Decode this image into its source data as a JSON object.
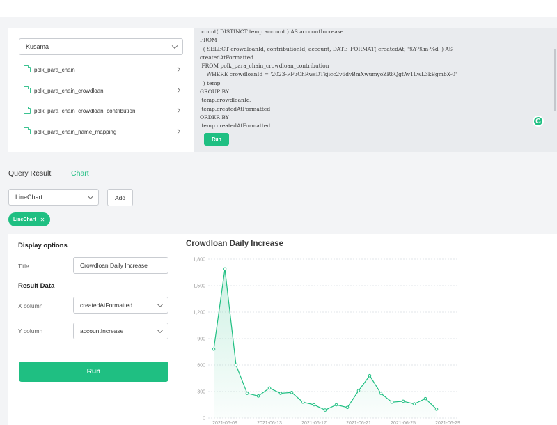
{
  "database_select": {
    "value": "Kusama"
  },
  "tables": [
    {
      "name": "polk_para_chain"
    },
    {
      "name": "polk_para_chain_crowdloan"
    },
    {
      "name": "polk_para_chain_crowdloan_contribution"
    },
    {
      "name": "polk_para_chain_name_mapping"
    }
  ],
  "editor": {
    "code_lines": [
      " count( DISTINCT temp.account ) AS accountIncrease",
      "FROM",
      "  ( SELECT crowdloanId, contributionId, account, DATE_FORMAT( createdAt, '%Y-%m-%d' ) AS",
      "createdAtFormatted",
      " FROM polk_para_chain_crowdloan_contribution",
      "    WHERE crowdloanId = '2023-FFuChRwsDTkjicc2v6dvBmXwumyoZR6QgfAv1LwL3kBgmbX-0'",
      "  ) temp",
      "GROUP BY",
      " temp.crowdloanId,",
      " temp.createdAtFormatted",
      "ORDER BY",
      " temp.createdAtFormatted"
    ],
    "run_label": "Run",
    "badge_letter": "G"
  },
  "tabs": {
    "result": "Query Result",
    "chart": "Chart"
  },
  "chart_type_select": {
    "value": "LineChart"
  },
  "add_label": "Add",
  "chip": {
    "label": "LineChart",
    "close": "✕"
  },
  "display_options": {
    "heading": "Display options",
    "title_label": "Title",
    "title_value": "Crowdloan Daily Increase",
    "result_heading": "Result Data",
    "x_label": "X column",
    "x_value": "createdAtFormatted",
    "y_label": "Y column",
    "y_value": "accountIncrease",
    "run_label": "Run"
  },
  "colors": {
    "accent": "#1fbf82"
  },
  "chart_data": {
    "type": "area",
    "title": "Crowdloan Daily Increase",
    "ylim": [
      0,
      1800
    ],
    "y_ticks": [
      0,
      300,
      600,
      900,
      1200,
      1500,
      1800
    ],
    "x_tick_labels": [
      "2021-06-09",
      "2021-06-13",
      "2021-06-17",
      "2021-06-21",
      "2021-06-25",
      "2021-06-29"
    ],
    "x": [
      "2021-06-08",
      "2021-06-09",
      "2021-06-10",
      "2021-06-11",
      "2021-06-12",
      "2021-06-13",
      "2021-06-14",
      "2021-06-15",
      "2021-06-16",
      "2021-06-17",
      "2021-06-18",
      "2021-06-19",
      "2021-06-20",
      "2021-06-21",
      "2021-06-22",
      "2021-06-23",
      "2021-06-24",
      "2021-06-25",
      "2021-06-26",
      "2021-06-27",
      "2021-06-28",
      "2021-06-29",
      "2021-06-30"
    ],
    "values": [
      780,
      1690,
      600,
      280,
      250,
      340,
      280,
      290,
      180,
      150,
      90,
      150,
      120,
      310,
      480,
      280,
      180,
      190,
      160,
      220,
      100
    ],
    "grid": true,
    "legend": "none"
  }
}
